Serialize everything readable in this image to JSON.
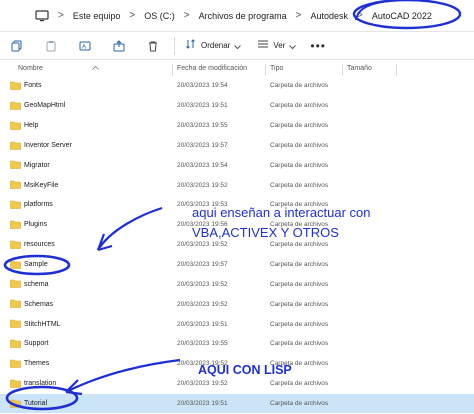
{
  "address_bar": {
    "crumbs": [
      "Este equipo",
      "OS (C:)",
      "Archivos de programa",
      "Autodesk",
      "AutoCAD 2022"
    ],
    "separator": ">",
    "monitor_icon": "monitor-icon"
  },
  "toolbar": {
    "sort_label": "Ordenar",
    "view_label": "Ver",
    "more_label": "•••"
  },
  "columns": {
    "name": "Nombre",
    "date": "Fecha de modificación",
    "type": "Tipo",
    "size": "Tamaño"
  },
  "files": [
    {
      "name": "Fonts",
      "date": "20/03/2023 19:54",
      "type": "Carpeta de archivos"
    },
    {
      "name": "GeoMapHtml",
      "date": "20/03/2023 19:51",
      "type": "Carpeta de archivos"
    },
    {
      "name": "Help",
      "date": "20/03/2023 19:55",
      "type": "Carpeta de archivos"
    },
    {
      "name": "Inventor Server",
      "date": "20/03/2023 19:57",
      "type": "Carpeta de archivos"
    },
    {
      "name": "Migrator",
      "date": "20/03/2023 19:54",
      "type": "Carpeta de archivos"
    },
    {
      "name": "MsiKeyFile",
      "date": "20/03/2023 19:52",
      "type": "Carpeta de archivos"
    },
    {
      "name": "platforms",
      "date": "20/03/2023 19:53",
      "type": "Carpeta de archivos"
    },
    {
      "name": "Plugins",
      "date": "20/03/2023 19:56",
      "type": "Carpeta de archivos"
    },
    {
      "name": "resources",
      "date": "20/03/2023 19:52",
      "type": "Carpeta de archivos"
    },
    {
      "name": "Sample",
      "date": "20/03/2023 19:57",
      "type": "Carpeta de archivos"
    },
    {
      "name": "schema",
      "date": "20/03/2023 19:52",
      "type": "Carpeta de archivos"
    },
    {
      "name": "Schemas",
      "date": "20/03/2023 19:52",
      "type": "Carpeta de archivos"
    },
    {
      "name": "StitchHTML",
      "date": "20/03/2023 19:51",
      "type": "Carpeta de archivos"
    },
    {
      "name": "Support",
      "date": "20/03/2023 19:55",
      "type": "Carpeta de archivos"
    },
    {
      "name": "Themes",
      "date": "20/03/2023 19:52",
      "type": "Carpeta de archivos"
    },
    {
      "name": "translation",
      "date": "20/03/2023 19:52",
      "type": "Carpeta de archivos"
    },
    {
      "name": "Tutorial",
      "date": "20/03/2023 19:51",
      "type": "Carpeta de archivos"
    }
  ],
  "selected_index": 16,
  "annotations": {
    "note_1": "aqui enseñan a interactuar con",
    "note_2": "VBA,ACTIVEX Y OTROS",
    "note_3": "AQUI CON LISP",
    "ink_color": "#1f2fd6"
  },
  "colors": {
    "folder": "#f2c84b",
    "selection": "#cce4f7",
    "accent": "#2563a8"
  }
}
